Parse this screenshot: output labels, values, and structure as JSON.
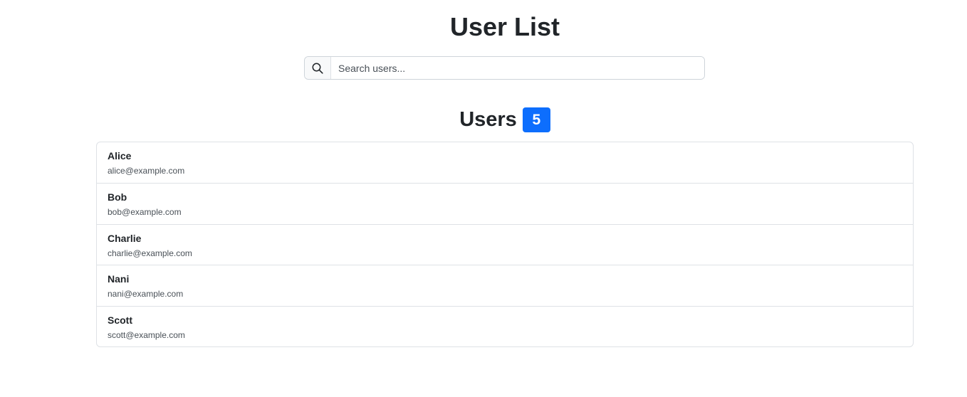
{
  "header": {
    "title": "User List"
  },
  "search": {
    "icon": "search-icon",
    "placeholder": "Search users..."
  },
  "section": {
    "title": "Users",
    "count": "5",
    "badge_color": "#0d6efd"
  },
  "users": [
    {
      "name": "Alice",
      "email": "alice@example.com"
    },
    {
      "name": "Bob",
      "email": "bob@example.com"
    },
    {
      "name": "Charlie",
      "email": "charlie@example.com"
    },
    {
      "name": "Nani",
      "email": "nani@example.com"
    },
    {
      "name": "Scott",
      "email": "scott@example.com"
    }
  ]
}
